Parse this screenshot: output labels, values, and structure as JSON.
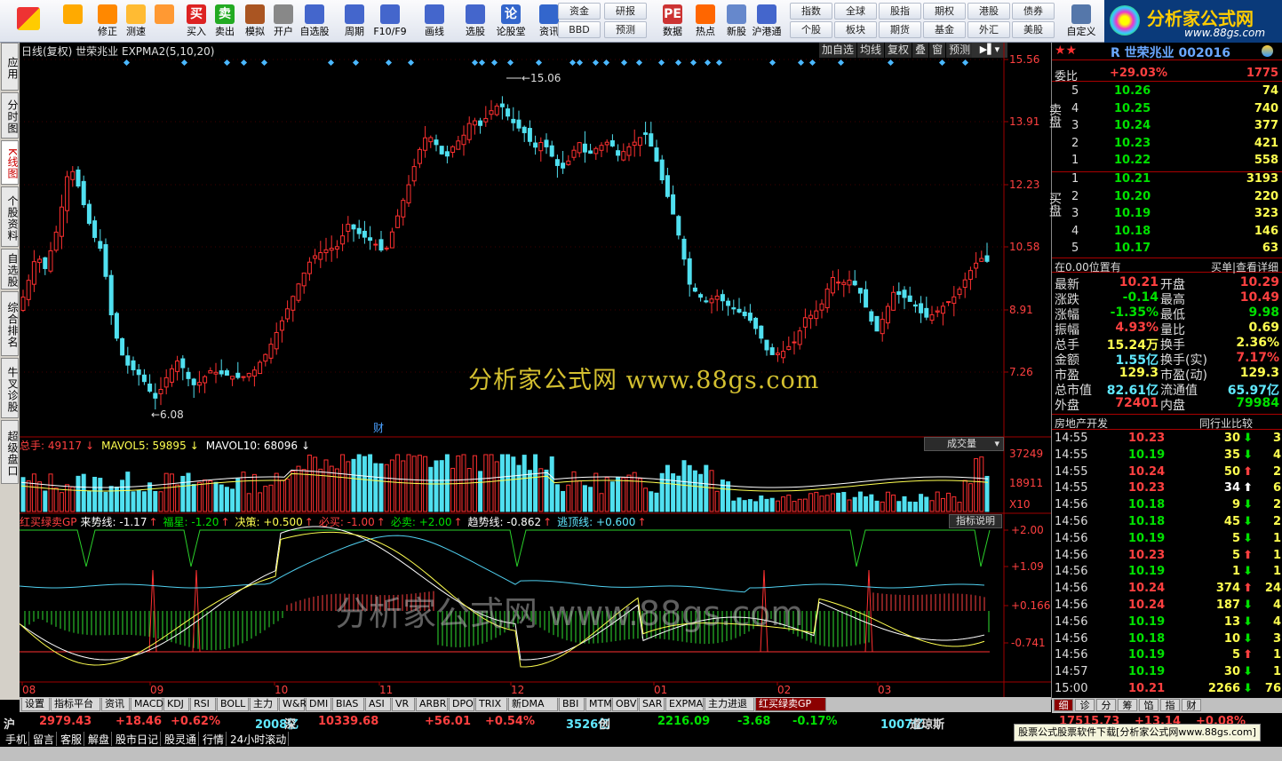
{
  "toolbar": {
    "buttons": [
      {
        "label": "",
        "icon": "logo-icon"
      },
      {
        "label": "",
        "icon": "back-icon"
      },
      {
        "label": "修正",
        "icon": "arrow-up-icon"
      },
      {
        "label": "测速",
        "icon": "refresh-icon"
      },
      {
        "label": "",
        "icon": "clock-icon"
      },
      {
        "label": "买入",
        "icon": "buy-icon",
        "glyph": "买"
      },
      {
        "label": "卖出",
        "icon": "sell-icon",
        "glyph": "卖"
      },
      {
        "label": "模拟",
        "icon": "hammer-icon"
      },
      {
        "label": "开户",
        "icon": "lock-icon"
      },
      {
        "label": "自选股",
        "icon": "star-icon"
      },
      {
        "label": "周期",
        "icon": "cycle-icon"
      },
      {
        "label": "F10/F9",
        "icon": "f10-icon"
      },
      {
        "label": "画线",
        "icon": "pen-icon"
      },
      {
        "label": "选股",
        "icon": "screen-icon"
      },
      {
        "label": "论股堂",
        "icon": "forum-icon",
        "glyph": "论"
      },
      {
        "label": "资讯",
        "icon": "news-icon"
      },
      {
        "label": "数据",
        "icon": "pe-icon",
        "glyph": "PE"
      },
      {
        "label": "热点",
        "icon": "fire-icon"
      },
      {
        "label": "新股",
        "icon": "newstock-icon"
      },
      {
        "label": "沪港通",
        "icon": "hk-icon"
      },
      {
        "label": "自定义",
        "icon": "custom-icon"
      }
    ],
    "small_buttons": [
      [
        "资金",
        "BBD"
      ],
      [
        "研报",
        "预测"
      ],
      [
        "指数",
        "个股"
      ],
      [
        "全球",
        "板块"
      ],
      [
        "股指",
        "期货"
      ],
      [
        "期权",
        "基金"
      ],
      [
        "港股",
        "外汇"
      ],
      [
        "债券",
        "美股"
      ]
    ],
    "brand_text": "分析家公式网",
    "brand_url": "www.88gs.com"
  },
  "vertical_tabs": [
    "应用",
    "分时图",
    "K线图",
    "个股资料",
    "自选股",
    "综合排名",
    "牛叉诊股",
    "超级盘口"
  ],
  "chart_header": {
    "title": "日线(复权)  世荣兆业  EXPMA2(5,10,20)",
    "right_buttons": [
      "加自选",
      "均线",
      "复权",
      "叠",
      "窗",
      "预测"
    ]
  },
  "chart_data": {
    "type": "candlestick",
    "price_axis": [
      "15.56",
      "13.91",
      "12.23",
      "10.58",
      "8.91",
      "7.26"
    ],
    "high_label": "15.06",
    "low_label": "6.08",
    "month_labels": [
      "08",
      "09",
      "10",
      "11",
      "12",
      "01",
      "02",
      "03"
    ],
    "fin_marker": "财",
    "volume_axis": [
      "37249",
      "18911",
      "X10"
    ],
    "indicator_axis": [
      "+2.00",
      "+1.09",
      "+0.166",
      "-0.741"
    ]
  },
  "volume_header": {
    "total": "总手: 49117",
    "mavol5": "MAVOL5: 59895",
    "mavol10": "MAVOL10: 68096",
    "dropdown": "成交量"
  },
  "indicator_header": {
    "name": "红买绿卖GP",
    "items": [
      {
        "text": "来势线: -1.17",
        "color": "#ffffff"
      },
      {
        "text": "福星: -1.20",
        "color": "#00e000"
      },
      {
        "text": "决策: +0.500",
        "color": "#ffff50"
      },
      {
        "text": "必买: -1.00",
        "color": "#ff4040"
      },
      {
        "text": "必卖: +2.00",
        "color": "#00e000"
      },
      {
        "text": "趋势线: -0.862",
        "color": "#ffffff"
      },
      {
        "text": "逃顶线: +0.600",
        "color": "#60e8ff"
      }
    ],
    "help": "指标说明"
  },
  "watermark": "分析家公式网  www.88gs.com",
  "right_panel": {
    "stock_name": "R 世荣兆业 002016",
    "weibi_label": "委比",
    "weibi_pct": "+29.03%",
    "weibi_val": "1775",
    "sell_label": "卖盘",
    "buy_label": "买盘",
    "sells": [
      [
        "5",
        "10.26",
        "74"
      ],
      [
        "4",
        "10.25",
        "740"
      ],
      [
        "3",
        "10.24",
        "377"
      ],
      [
        "2",
        "10.23",
        "421"
      ],
      [
        "1",
        "10.22",
        "558"
      ]
    ],
    "buys": [
      [
        "1",
        "10.21",
        "3193"
      ],
      [
        "2",
        "10.20",
        "220"
      ],
      [
        "3",
        "10.19",
        "323"
      ],
      [
        "4",
        "10.18",
        "146"
      ],
      [
        "5",
        "10.17",
        "63"
      ]
    ],
    "pos_label": "在0.00位置有",
    "buy_single": "买单|查看详细",
    "quote": [
      [
        "最新",
        "10.21",
        "开盘",
        "10.29"
      ],
      [
        "涨跌",
        "-0.14",
        "最高",
        "10.49"
      ],
      [
        "涨幅",
        "-1.35%",
        "最低",
        "9.98"
      ],
      [
        "振幅",
        "4.93%",
        "量比",
        "0.69"
      ],
      [
        "总手",
        "15.24万",
        "换手",
        "2.36%"
      ],
      [
        "金额",
        "1.55亿",
        "换手(实)",
        "7.17%"
      ],
      [
        "市盈",
        "129.3",
        "市盈(动)",
        "129.3"
      ],
      [
        "总市值",
        "82.61亿",
        "流通值",
        "65.97亿"
      ],
      [
        "外盘",
        "72401",
        "内盘",
        "79984"
      ]
    ],
    "sector": "房地产开发",
    "compare": "同行业比较",
    "ticks": [
      [
        "14:55",
        "10.23",
        "30",
        "down",
        "3"
      ],
      [
        "14:55",
        "10.19",
        "35",
        "down",
        "4"
      ],
      [
        "14:55",
        "10.24",
        "50",
        "up",
        "2"
      ],
      [
        "14:55",
        "10.23",
        "34",
        "upw",
        "6"
      ],
      [
        "14:56",
        "10.18",
        "9",
        "down",
        "2"
      ],
      [
        "14:56",
        "10.18",
        "45",
        "down",
        "2"
      ],
      [
        "14:56",
        "10.19",
        "5",
        "down",
        "1"
      ],
      [
        "14:56",
        "10.23",
        "5",
        "up",
        "1"
      ],
      [
        "14:56",
        "10.19",
        "1",
        "down",
        "1"
      ],
      [
        "14:56",
        "10.24",
        "374",
        "up",
        "24"
      ],
      [
        "14:56",
        "10.24",
        "187",
        "down",
        "4"
      ],
      [
        "14:56",
        "10.19",
        "13",
        "down",
        "4"
      ],
      [
        "14:56",
        "10.18",
        "10",
        "down",
        "3"
      ],
      [
        "14:56",
        "10.19",
        "5",
        "up",
        "1"
      ],
      [
        "14:57",
        "10.19",
        "30",
        "down",
        "1"
      ],
      [
        "15:00",
        "10.21",
        "2266",
        "down",
        "76"
      ]
    ],
    "bottom_tabs": [
      "细",
      "诊",
      "分",
      "筹",
      "馅",
      "指",
      "财"
    ]
  },
  "bottom_tabs": [
    "设置",
    "指标平台",
    "资讯",
    "MACD",
    "KDJ",
    "RSI",
    "BOLL",
    "主力",
    "W&R",
    "DMI",
    "BIAS",
    "ASI",
    "VR",
    "ARBR",
    "DPO",
    "TRIX",
    "新DMA",
    "BBI",
    "MTM",
    "OBV",
    "SAR",
    "EXPMA",
    "主力进退",
    "红买绿卖GP"
  ],
  "index_bar": {
    "sh_label": "沪",
    "sh_val": "2979.43",
    "sh_chg": "+18.46",
    "sh_pct": "+0.62%",
    "sh_amt": "2008亿",
    "sz_label": "深",
    "sz_val": "10339.68",
    "sz_chg": "+56.01",
    "sz_pct": "+0.54%",
    "sz_amt": "3526亿",
    "cy_label": "创",
    "cy_val": "2216.09",
    "cy_chg": "-3.68",
    "cy_pct": "-0.17%",
    "cy_amt": "1007亿",
    "dj_label": "道琼斯",
    "dj_val": "17515.73",
    "dj_chg": "+13.14",
    "dj_pct": "+0.08%"
  },
  "status_bar": {
    "items": [
      "手机",
      "留言",
      "客服",
      "解盘",
      "股市日记",
      "股灵通",
      "行情",
      "24小时滚动"
    ],
    "promo": "股票公式股票软件下载[分析家公式网www.88gs.com]"
  }
}
